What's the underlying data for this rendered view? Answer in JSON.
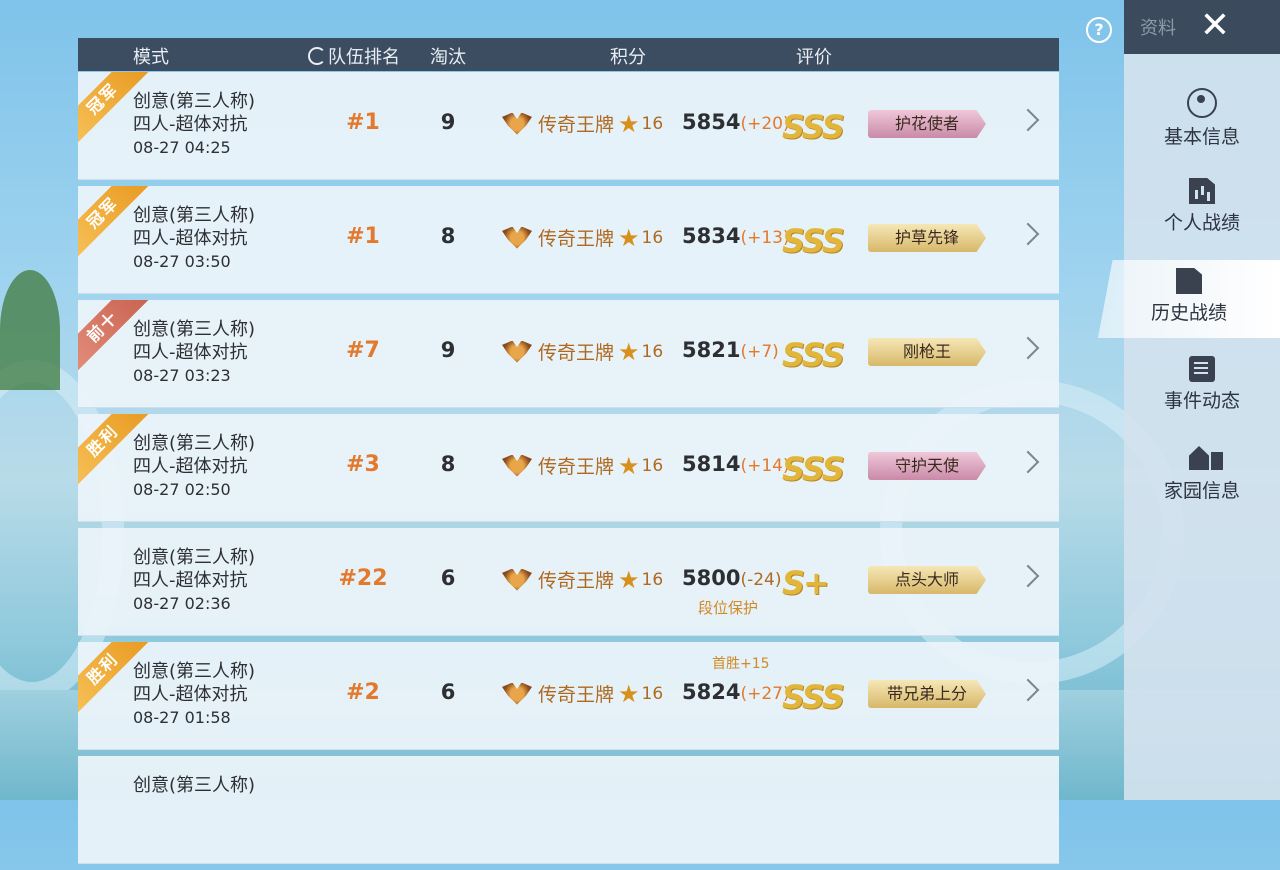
{
  "header": {
    "mode": "模式",
    "rank": "队伍排名",
    "kills": "淘汰",
    "score": "积分",
    "rating": "评价"
  },
  "rows": [
    {
      "ribbon": "冠军",
      "ribbon_color": "gold",
      "mode_line1": "创意(第三人称)",
      "mode_line2": "四人-超体对抗",
      "time": "08-27 04:25",
      "rank": "#1",
      "kills": "9",
      "tier": "传奇王牌",
      "stars": "16",
      "score": "5854",
      "delta": "(+20)",
      "note": "",
      "note_top": "",
      "grade": "SSS",
      "title": "护花使者",
      "title_style": "pink"
    },
    {
      "ribbon": "冠军",
      "ribbon_color": "gold",
      "mode_line1": "创意(第三人称)",
      "mode_line2": "四人-超体对抗",
      "time": "08-27 03:50",
      "rank": "#1",
      "kills": "8",
      "tier": "传奇王牌",
      "stars": "16",
      "score": "5834",
      "delta": "(+13)",
      "note": "",
      "note_top": "",
      "grade": "SSS",
      "title": "护草先锋",
      "title_style": "gold"
    },
    {
      "ribbon": "前十",
      "ribbon_color": "red",
      "mode_line1": "创意(第三人称)",
      "mode_line2": "四人-超体对抗",
      "time": "08-27 03:23",
      "rank": "#7",
      "kills": "9",
      "tier": "传奇王牌",
      "stars": "16",
      "score": "5821",
      "delta": "(+7)",
      "note": "",
      "note_top": "",
      "grade": "SSS",
      "title": "刚枪王",
      "title_style": "gold"
    },
    {
      "ribbon": "胜利",
      "ribbon_color": "gold",
      "mode_line1": "创意(第三人称)",
      "mode_line2": "四人-超体对抗",
      "time": "08-27 02:50",
      "rank": "#3",
      "kills": "8",
      "tier": "传奇王牌",
      "stars": "16",
      "score": "5814",
      "delta": "(+14)",
      "note": "",
      "note_top": "",
      "grade": "SSS",
      "title": "守护天使",
      "title_style": "pink"
    },
    {
      "ribbon": "",
      "ribbon_color": "",
      "mode_line1": "创意(第三人称)",
      "mode_line2": "四人-超体对抗",
      "time": "08-27 02:36",
      "rank": "#22",
      "kills": "6",
      "tier": "传奇王牌",
      "stars": "16",
      "score": "5800",
      "delta": "(-24)",
      "note": "段位保护",
      "note_top": "",
      "grade": "S+",
      "title": "点头大师",
      "title_style": "gold"
    },
    {
      "ribbon": "胜利",
      "ribbon_color": "gold",
      "mode_line1": "创意(第三人称)",
      "mode_line2": "四人-超体对抗",
      "time": "08-27 01:58",
      "rank": "#2",
      "kills": "6",
      "tier": "传奇王牌",
      "stars": "16",
      "score": "5824",
      "delta": "(+27)",
      "note": "",
      "note_top": "首胜+15",
      "grade": "SSS",
      "title": "带兄弟上分",
      "title_style": "gold"
    },
    {
      "ribbon": "",
      "ribbon_color": "",
      "mode_line1": "创意(第三人称)",
      "mode_line2": "",
      "time": "",
      "rank": "",
      "kills": "",
      "tier": "",
      "stars": "",
      "score": "",
      "delta": "",
      "note": "",
      "note_top": "",
      "grade": "",
      "title": "",
      "title_style": ""
    }
  ],
  "topbar": {
    "ziliao": "资料",
    "help": "?",
    "close": "✕"
  },
  "sidebar": {
    "items": [
      {
        "label": "基本信息",
        "icon": "user-icon"
      },
      {
        "label": "个人战绩",
        "icon": "stats-doc-icon"
      },
      {
        "label": "历史战绩",
        "icon": "history-doc-icon",
        "active": true
      },
      {
        "label": "事件动态",
        "icon": "event-icon"
      },
      {
        "label": "家园信息",
        "icon": "home-icon"
      }
    ]
  },
  "colors": {
    "accent_orange": "#e3792c",
    "header_bg": "#3c4d62",
    "gold": "#e2b63a"
  }
}
